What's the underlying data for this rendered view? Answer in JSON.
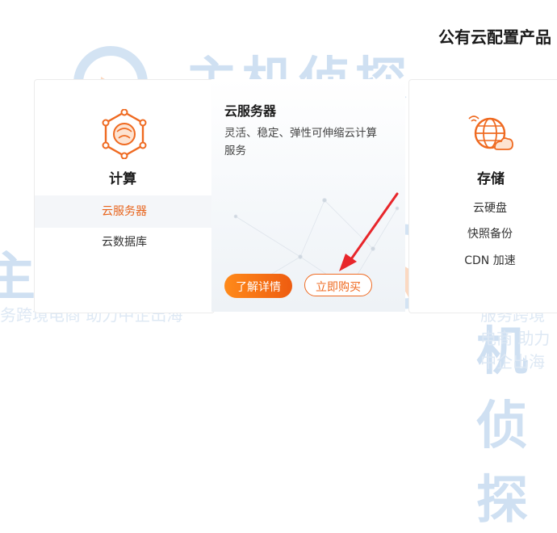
{
  "page": {
    "section_title": "公有云配置产品",
    "watermark": {
      "brand": "主机侦探",
      "slogan": "服务跨境电商 助力中企出海"
    }
  },
  "compute": {
    "icon": "compute-hexagon-icon",
    "title": "计算",
    "menu": [
      {
        "label": "云服务器",
        "active": true
      },
      {
        "label": "云数据库",
        "active": false
      }
    ]
  },
  "detail": {
    "title": "云服务器",
    "description": "灵活、稳定、弹性可伸缩云计算服务",
    "detail_button": "了解详情",
    "buy_button": "立即购买"
  },
  "storage": {
    "icon": "cloud-globe-storage-icon",
    "title": "存储",
    "items": [
      "云硬盘",
      "快照备份",
      "CDN 加速"
    ]
  },
  "colors": {
    "accent": "#ef6a21",
    "watermark": "#cfe0f2"
  }
}
